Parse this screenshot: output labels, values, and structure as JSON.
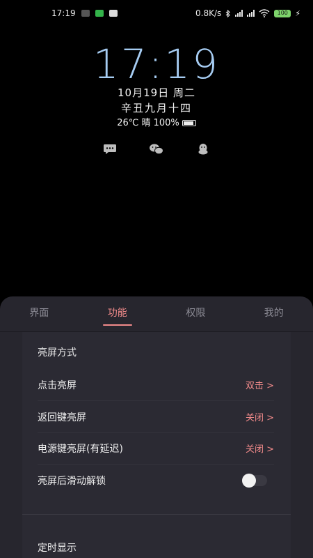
{
  "status_bar": {
    "time": "17:19",
    "net_speed": "0.8K/s",
    "battery": "100"
  },
  "lock_preview": {
    "clock": "17:19",
    "date": "10月19日 周二",
    "lunar": "辛丑九月十四",
    "weather": "26℃ 晴  100%"
  },
  "tabs": [
    {
      "label": "界面"
    },
    {
      "label": "功能"
    },
    {
      "label": "权限"
    },
    {
      "label": "我的"
    }
  ],
  "settings": {
    "section_wake": "亮屏方式",
    "rows": [
      {
        "label": "点击亮屏",
        "value": "双击 >"
      },
      {
        "label": "返回键亮屏",
        "value": "关闭 >"
      },
      {
        "label": "电源键亮屏(有延迟)",
        "value": "关闭 >"
      },
      {
        "label": "亮屏后滑动解锁"
      }
    ],
    "section_timer": "定时显示"
  },
  "colors": {
    "accent": "#f28b8b",
    "clock": "#a6ccf2",
    "sheet_bg": "#27262e"
  }
}
